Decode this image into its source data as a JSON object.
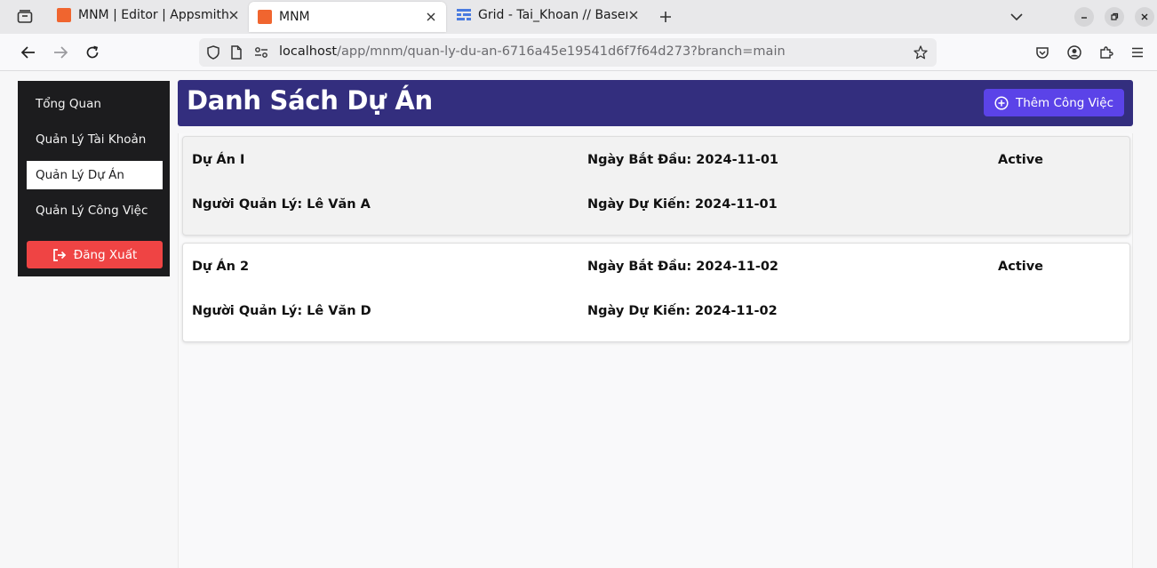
{
  "browser": {
    "tabs": [
      {
        "title": "MNM | Editor | Appsmith",
        "active": false
      },
      {
        "title": "MNM",
        "active": true
      },
      {
        "title": "Grid - Tai_Khoan // Basero",
        "active": false
      }
    ],
    "url": {
      "host": "localhost",
      "path": "/app/mnm/quan-ly-du-an-6716a45e19541d6f7f64d273?branch=main"
    }
  },
  "sidebar": {
    "items": [
      {
        "label": "Tổng Quan",
        "active": false
      },
      {
        "label": "Quản Lý Tài Khoản",
        "active": false
      },
      {
        "label": "Quản Lý Dự Án",
        "active": true
      },
      {
        "label": "Quản Lý Công Việc",
        "active": false
      }
    ],
    "logout_label": "Đăng Xuất"
  },
  "header": {
    "title": "Danh Sách Dự Án",
    "add_button_label": "Thêm Công Việc"
  },
  "projects": [
    {
      "name": "Dự Án I",
      "manager": "Người Quản Lý: Lê Văn A",
      "start": "Ngày Bắt Đầu: 2024-11-01",
      "expected": "Ngày Dự Kiến: 2024-11-01",
      "status": "Active"
    },
    {
      "name": "Dự Án 2",
      "manager": "Người Quản Lý: Lê Văn D",
      "start": "Ngày Bắt Đầu: 2024-11-02",
      "expected": "Ngày Dự Kiến: 2024-11-02",
      "status": "Active"
    }
  ],
  "colors": {
    "header_bg": "#332e7e",
    "add_button": "#5b43e8",
    "logout_button": "#ef4444",
    "sidebar_bg": "#1c1c1e",
    "favicon": "#f0652f"
  }
}
